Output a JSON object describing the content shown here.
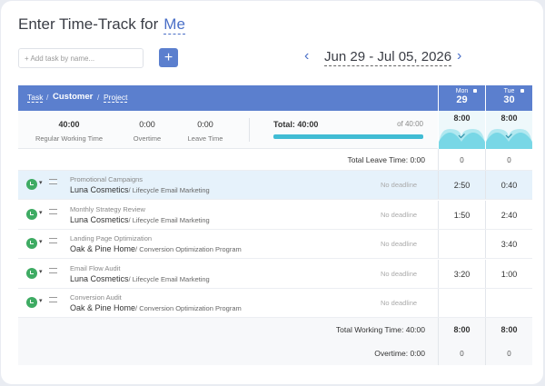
{
  "header": {
    "title_prefix": "Enter Time-Track for",
    "title_user": "Me",
    "add_task_placeholder": "+ Add task by name...",
    "add_button_label": "+",
    "prev_arrow": "‹",
    "next_arrow": "›",
    "date_range": "Jun 29 - Jul 05, 2026"
  },
  "columns": {
    "task": "Task",
    "sep": "/",
    "customer": "Customer",
    "project": "Project"
  },
  "days": [
    {
      "name": "Mon",
      "date": "29",
      "hours": "8:00",
      "leave": "0",
      "total": "8:00",
      "overtime": "0"
    },
    {
      "name": "Tue",
      "date": "30",
      "hours": "8:00",
      "leave": "0",
      "total": "8:00",
      "overtime": "0"
    }
  ],
  "summary": {
    "regular_value": "40:00",
    "regular_label": "Regular Working Time",
    "overtime_value": "0:00",
    "overtime_label": "Overtime",
    "leave_value": "0:00",
    "leave_label": "Leave Time",
    "total_label": "Total: 40:00",
    "total_of": "of 40:00",
    "progress": 1.0
  },
  "leave_row_label": "Total Leave Time: 0:00",
  "tasks": [
    {
      "name": "Promotional Campaigns",
      "customer": "Luna Cosmetics",
      "project": "/ Lifecycle Email Marketing",
      "deadline": "No deadline",
      "mon": "2:50",
      "tue": "0:40"
    },
    {
      "name": "Monthly Strategy Review",
      "customer": "Luna Cosmetics",
      "project": "/ Lifecycle Email Marketing",
      "deadline": "No deadline",
      "mon": "1:50",
      "tue": "2:40"
    },
    {
      "name": "Landing Page Optimization",
      "customer": "Oak & Pine Home",
      "project": "/ Conversion Optimization Program",
      "deadline": "No deadline",
      "mon": "",
      "tue": "3:40"
    },
    {
      "name": "Email Flow Audit",
      "customer": "Luna Cosmetics",
      "project": "/ Lifecycle Email Marketing",
      "deadline": "No deadline",
      "mon": "3:20",
      "tue": "1:00"
    },
    {
      "name": "Conversion Audit",
      "customer": "Oak & Pine Home",
      "project": "/ Conversion Optimization Program",
      "deadline": "No deadline",
      "mon": "",
      "tue": ""
    }
  ],
  "footer": {
    "total_working_label": "Total Working Time: 40:00",
    "overtime_label": "Overtime: 0:00"
  },
  "colors": {
    "accent": "#5b7fce",
    "progress": "#41bcd4",
    "clock": "#3eab63"
  }
}
